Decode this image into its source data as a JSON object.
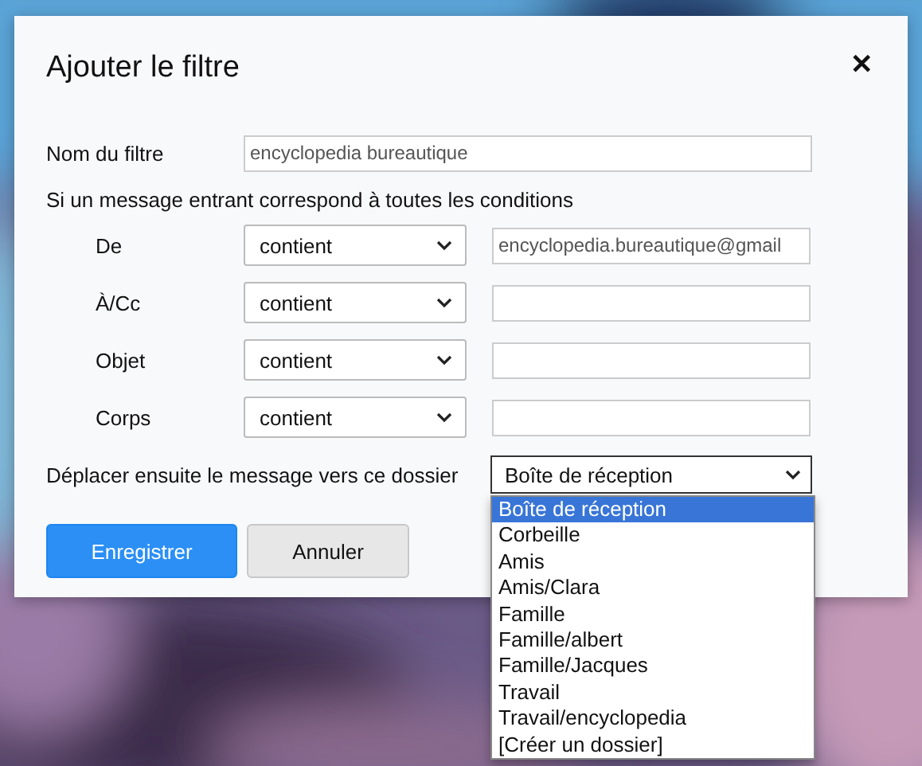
{
  "dialog": {
    "title": "Ajouter le filtre",
    "close": "✕"
  },
  "filter_name": {
    "label": "Nom du filtre",
    "value": "encyclopedia bureautique"
  },
  "conditions_heading": "Si un message entrant correspond à toutes les conditions",
  "conditions": [
    {
      "label": "De",
      "operator": "contient",
      "value": "encyclopedia.bureautique@gmail"
    },
    {
      "label": "À/Cc",
      "operator": "contient"
    },
    {
      "label": "Objet",
      "operator": "contient"
    },
    {
      "label": "Corps",
      "operator": "contient"
    }
  ],
  "folder": {
    "label": "Déplacer ensuite le message vers ce dossier",
    "value": "Boîte de réception",
    "expanded": true,
    "options": [
      {
        "label": "Boîte de réception",
        "selected": true
      },
      {
        "label": "Corbeille",
        "selected": false
      },
      {
        "label": "Amis",
        "selected": false
      },
      {
        "label": "Amis/Clara",
        "selected": false
      },
      {
        "label": "Famille",
        "selected": false
      },
      {
        "label": "Famille/albert",
        "selected": false
      },
      {
        "label": "Famille/Jacques",
        "selected": false
      },
      {
        "label": "Travail",
        "selected": false
      },
      {
        "label": "Travail/encyclopedia",
        "selected": false
      },
      {
        "label": "[Créer un dossier]",
        "selected": false
      }
    ]
  },
  "buttons": [
    {
      "label": "Enregistrer",
      "kind": "primary"
    },
    {
      "label": "Annuler",
      "kind": "secondary"
    }
  ]
}
